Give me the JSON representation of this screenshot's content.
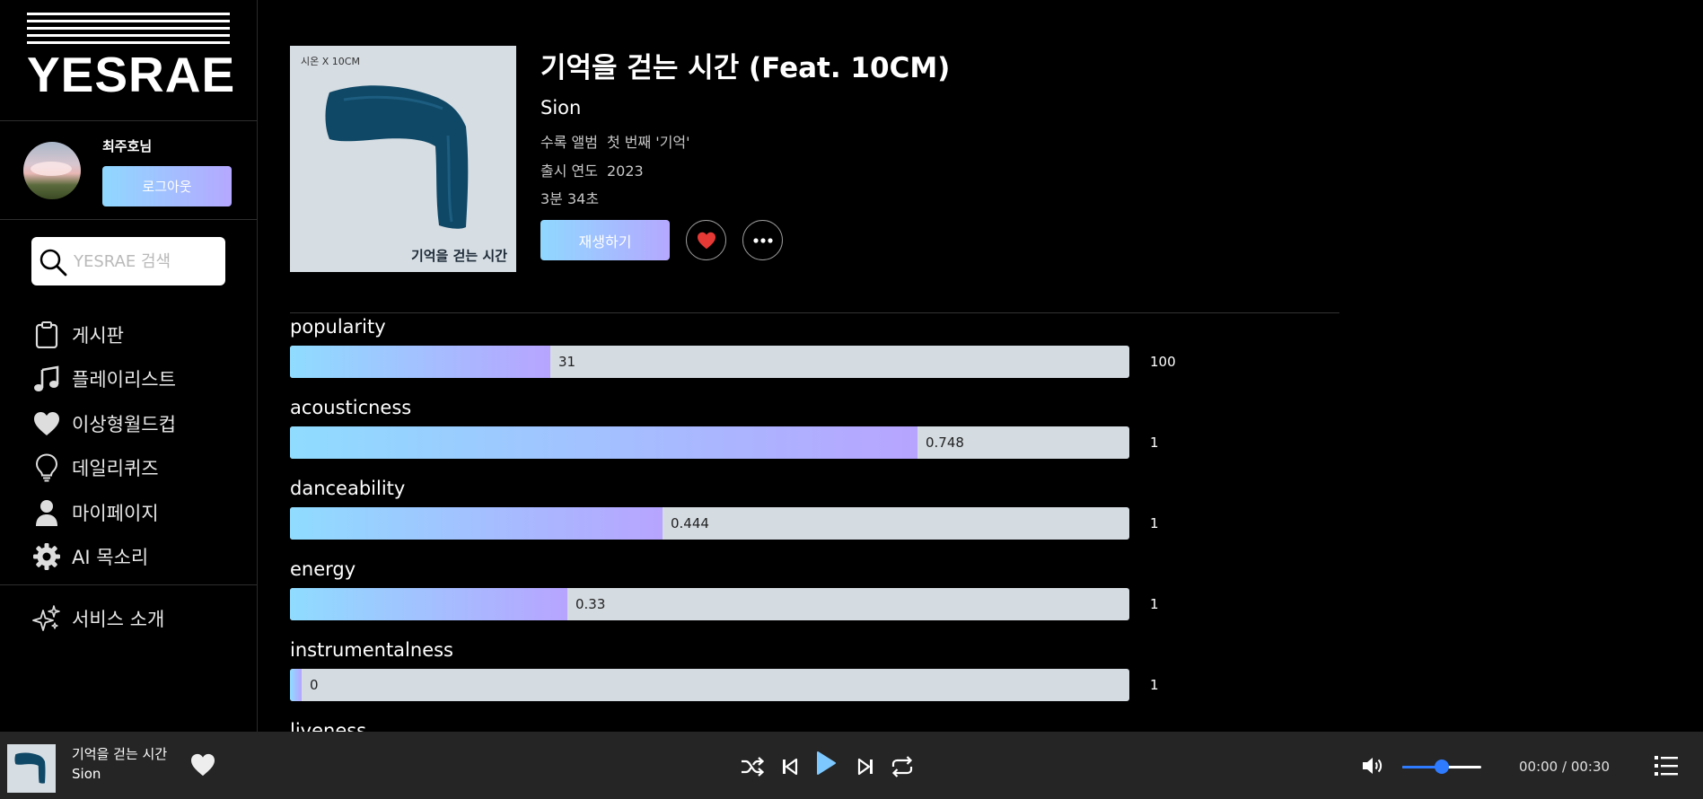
{
  "brand": {
    "logo_text": "YESRAE"
  },
  "user": {
    "name": "최주호님",
    "logout_label": "로그아웃"
  },
  "search": {
    "placeholder": "YESRAE 검색",
    "value": ""
  },
  "nav": {
    "items": [
      {
        "label": "게시판",
        "icon": "clipboard-icon"
      },
      {
        "label": "플레이리스트",
        "icon": "music-note-icon"
      },
      {
        "label": "이상형월드컵",
        "icon": "heart-icon"
      },
      {
        "label": "데일리퀴즈",
        "icon": "lightbulb-icon"
      },
      {
        "label": "마이페이지",
        "icon": "person-icon"
      },
      {
        "label": "AI 목소리",
        "icon": "gear-icon"
      }
    ],
    "extra": {
      "label": "서비스 소개",
      "icon": "sparkles-icon"
    }
  },
  "song": {
    "cover_top_text": "시온 X 10CM",
    "cover_bottom_text": "기억을 걷는 시간",
    "title": "기억을 걷는 시간 (Feat. 10CM)",
    "artist": "Sion",
    "album_key": "수록 앨범",
    "album_value": "첫 번째 '기억'",
    "year_key": "출시 연도",
    "year_value": "2023",
    "duration": "3분 34초",
    "play_label": "재생하기",
    "liked": true
  },
  "colors": {
    "accent_start": "#8fd8ff",
    "accent_end": "#b5a8ff",
    "like_red": "#e53935",
    "volume_blue": "#2f7bff"
  },
  "stats": [
    {
      "name": "popularity",
      "value": 31,
      "value_label": "31",
      "max": 100,
      "max_label": "100"
    },
    {
      "name": "acousticness",
      "value": 0.748,
      "value_label": "0.748",
      "max": 1,
      "max_label": "1"
    },
    {
      "name": "danceability",
      "value": 0.444,
      "value_label": "0.444",
      "max": 1,
      "max_label": "1"
    },
    {
      "name": "energy",
      "value": 0.33,
      "value_label": "0.33",
      "max": 1,
      "max_label": "1"
    },
    {
      "name": "instrumentalness",
      "value": 0,
      "value_label": "0",
      "max": 1,
      "max_label": "1"
    },
    {
      "name": "liveness",
      "value": null,
      "value_label": "",
      "max": 1,
      "max_label": ""
    }
  ],
  "player": {
    "title": "기억을 걷는 시간",
    "artist": "Sion",
    "time": "00:00 / 00:30",
    "volume": 0.5
  }
}
